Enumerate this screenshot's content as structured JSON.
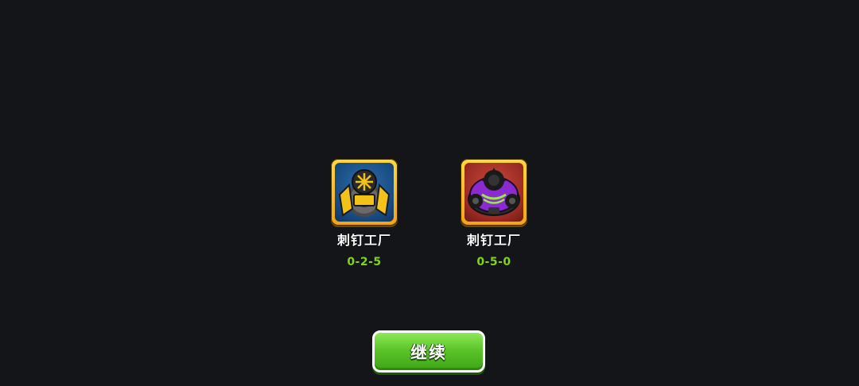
{
  "towers": [
    {
      "name": "刺钉工厂",
      "path": "0-2-5",
      "icon": "spike-factory-yellow-icon",
      "frame_color": "#f7c01f",
      "accent_color": "#f2c21a"
    },
    {
      "name": "刺钉工厂",
      "path": "0-5-0",
      "icon": "spike-factory-purple-icon",
      "frame_color": "#f7c01f",
      "accent_color": "#8a2ad0"
    }
  ],
  "continue_button": {
    "label": "继续",
    "color": "#5cc52a"
  },
  "background_color": "#141519",
  "path_text_color": "#7fd420"
}
